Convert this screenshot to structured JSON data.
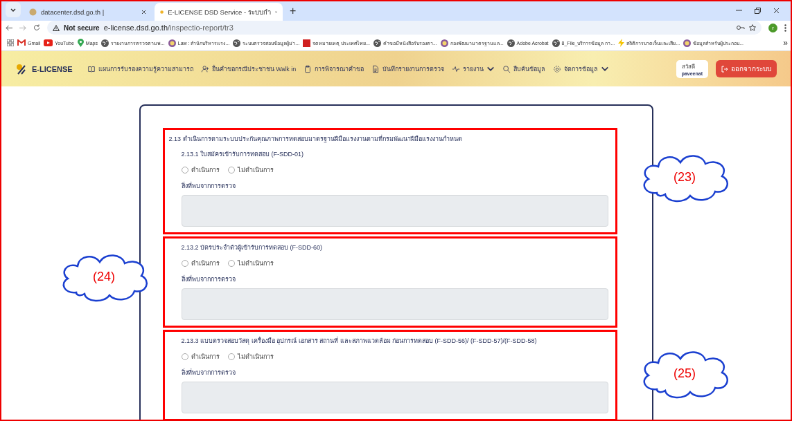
{
  "browser": {
    "tabs": [
      {
        "title": "datacenter.dsd.go.th |",
        "selected": false
      },
      {
        "title": "E-LICENSE DSD Service - ระบบกำ",
        "selected": true
      }
    ],
    "new_tab": "+",
    "address": {
      "security": "Not secure",
      "host": "e-license.dsd.go.th",
      "path": "/inspectio-report/tr3"
    },
    "profile_initial": "r",
    "bookmarks": [
      {
        "label": "Gmail",
        "kind": "gmail"
      },
      {
        "label": "YouTube",
        "kind": "youtube"
      },
      {
        "label": "Maps",
        "kind": "maps"
      },
      {
        "label": "รายงานการตรวจตามพ...",
        "kind": "globe"
      },
      {
        "label": "Law : สำนักบริหารแรง...",
        "kind": "seal"
      },
      {
        "label": "ระบบตรวจสอบข้อมูลผู้ม่า...",
        "kind": "globe"
      },
      {
        "label": "จดหมายเหตุ ประเทศไทย...",
        "kind": "red"
      },
      {
        "label": "คำขอมีหนังสือรับรองตา...",
        "kind": "globe"
      },
      {
        "label": "กองพัฒนามาตรฐานแล...",
        "kind": "seal"
      },
      {
        "label": "Adobe Acrobat",
        "kind": "globe"
      },
      {
        "label": "8_File_บริการข้อมูล กา...",
        "kind": "globe"
      },
      {
        "label": "สถิติการบาดเจ็บและเสีย...",
        "kind": "bolt"
      },
      {
        "label": "ข้อมูลสำหรับผู้ประกอบ...",
        "kind": "seal"
      }
    ],
    "more": "»"
  },
  "app": {
    "brand": "E-LICENSE",
    "nav": [
      {
        "label": "แผนการรับรองความรู้ความสามารถ",
        "kind": "book",
        "dropdown": false
      },
      {
        "label": "ยื่นคำขอกรณีประชาชน Walk in",
        "kind": "user",
        "dropdown": false
      },
      {
        "label": "การพิจารณาคำขอ",
        "kind": "clipboard",
        "dropdown": false
      },
      {
        "label": "บันทึกรายงานการตรวจ",
        "kind": "doc",
        "dropdown": false
      },
      {
        "label": "รายงาน",
        "kind": "pulse",
        "dropdown": true
      },
      {
        "label": "สืบค้นข้อมูล",
        "kind": "search",
        "dropdown": false
      },
      {
        "label": "จัดการข้อมูล",
        "kind": "gear",
        "dropdown": true
      }
    ],
    "greeting": "สวัสดี",
    "username": "paveenat",
    "logout": "ออกจากระบบ"
  },
  "sections": [
    {
      "callout": "(23)",
      "heading": "2.13 ดำเนินการตามระบบประกันคุณภาพการทดสอบมาตรฐานฝีมือแรงงานตามที่กรมพัฒนาฝีมือแรงงานกำหนด",
      "item": {
        "title": "2.13.1 ใบสมัครเข้ารับการทดสอบ (F-SDD-01)",
        "options": [
          {
            "label": "ดำเนินการ",
            "selected": false
          },
          {
            "label": "ไม่ดำเนินการ",
            "selected": false
          }
        ],
        "findings_label": "สิ่งที่พบจากการตรวจ"
      }
    },
    {
      "callout": "(24)",
      "item": {
        "title": "2.13.2 บัตรประจำตัวผู้เข้ารับการทดสอบ (F-SDD-60)",
        "options": [
          {
            "label": "ดำเนินการ",
            "selected": false
          },
          {
            "label": "ไม่ดำเนินการ",
            "selected": false
          }
        ],
        "findings_label": "สิ่งที่พบจากการตรวจ"
      }
    },
    {
      "callout": "(25)",
      "item": {
        "title": "2.13.3  แบบตรวจสอบวัสดุ เครื่องมือ อุปกรณ์ เอกสาร สถานที่ และสภาพแวดล้อม ก่อนการทดสอบ (F-SDD-56)/ (F-SDD-57)/(F-SDD-58)",
        "options": [
          {
            "label": "ดำเนินการ",
            "selected": false
          },
          {
            "label": "ไม่ดำเนินการ",
            "selected": false
          }
        ],
        "findings_label": "สิ่งที่พบจากการตรวจ"
      }
    }
  ]
}
